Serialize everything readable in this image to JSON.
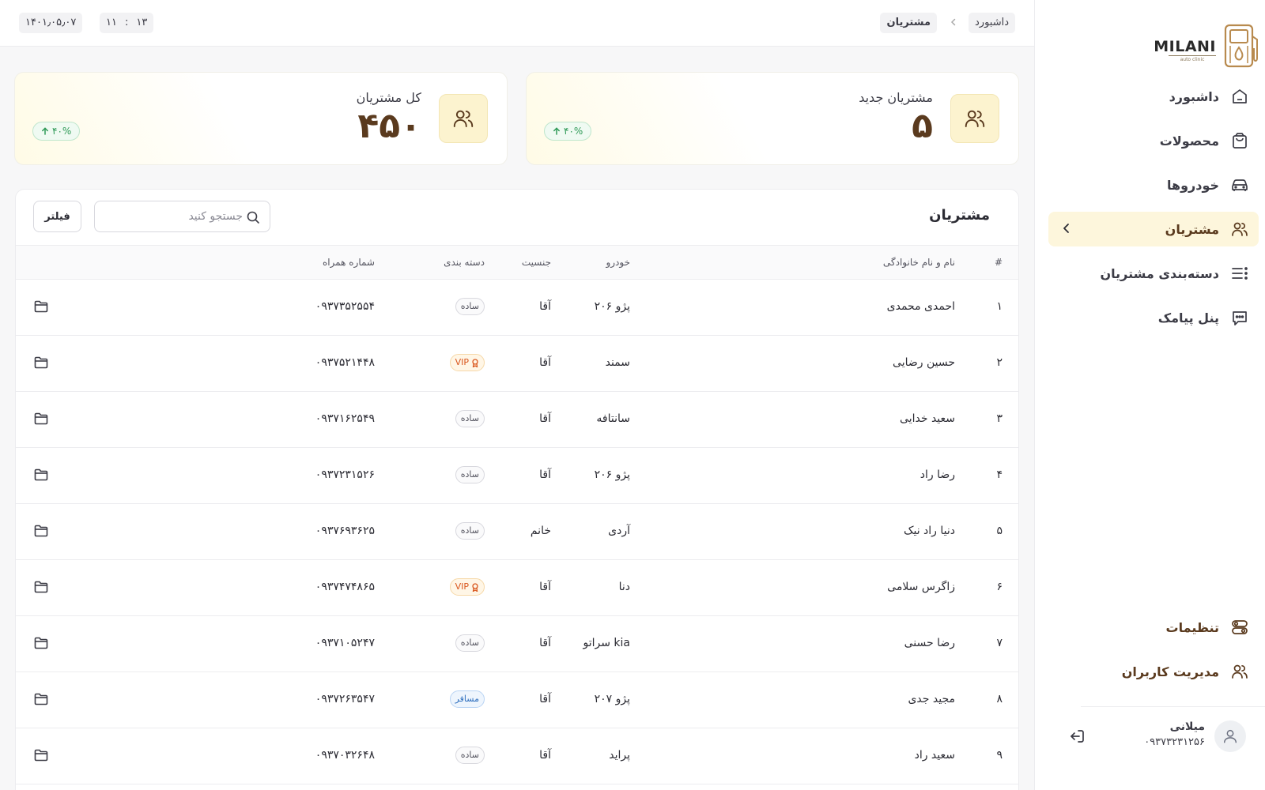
{
  "brand": {
    "name": "MILANI",
    "subtitle": "auto clinic"
  },
  "sidebar": {
    "items": [
      {
        "label": "داشبورد",
        "icon": "home-icon"
      },
      {
        "label": "محصولات",
        "icon": "shopping-bag-icon"
      },
      {
        "label": "خودروها",
        "icon": "car-icon"
      },
      {
        "label": "مشتریان",
        "icon": "users-icon",
        "active": true
      },
      {
        "label": "دسته‌بندی مشتریان",
        "icon": "list-icon"
      },
      {
        "label": "پنل پیامک",
        "icon": "message-icon"
      }
    ],
    "bottom_items": [
      {
        "label": "تنظیمات",
        "icon": "settings-icon"
      },
      {
        "label": "مدیریت کاربران",
        "icon": "users-manage-icon"
      }
    ],
    "user": {
      "name": "میلانی",
      "phone": "۰۹۳۷۳۲۳۱۲۵۶"
    }
  },
  "header": {
    "breadcrumb": [
      "داشبورد",
      "مشتریان"
    ],
    "date": "۱۴۰۱٫۰۵٫۰۷",
    "time": {
      "hour": "۱۳",
      "sep": ":",
      "minute": "۱۱"
    }
  },
  "stats": [
    {
      "title": "مشتریان جدید",
      "value": "۵",
      "change": "۴۰%"
    },
    {
      "title": "کل مشتریان",
      "value": "۴۵۰",
      "change": "۴۰%"
    }
  ],
  "table": {
    "title": "مشتریان",
    "search_placeholder": "جستجو کنید",
    "filter_label": "فیلتر",
    "columns": {
      "idx": "#",
      "name": "نام و نام خانوادگی",
      "car": "خودرو",
      "gender": "جنسیت",
      "category": "دسته بندی",
      "phone": "شماره همراه"
    },
    "rows": [
      {
        "idx": "۱",
        "name": "احمدی محمدی",
        "car": "پژو ۲۰۶",
        "gender": "آقا",
        "category": "ساده",
        "category_type": "simple",
        "phone": "۰۹۳۷۳۵۲۵۵۴"
      },
      {
        "idx": "۲",
        "name": "حسین رضایی",
        "car": "سمند",
        "gender": "آقا",
        "category": "VIP",
        "category_type": "vip",
        "phone": "۰۹۳۷۵۲۱۴۴۸"
      },
      {
        "idx": "۳",
        "name": "سعید خدایی",
        "car": "سانتافه",
        "gender": "آقا",
        "category": "ساده",
        "category_type": "simple",
        "phone": "۰۹۳۷۱۶۲۵۴۹"
      },
      {
        "idx": "۴",
        "name": "رضا راد",
        "car": "پژو ۲۰۶",
        "gender": "آقا",
        "category": "ساده",
        "category_type": "simple",
        "phone": "۰۹۳۷۲۳۱۵۲۶"
      },
      {
        "idx": "۵",
        "name": "دنیا راد نیک",
        "car": "آردی",
        "gender": "خانم",
        "category": "ساده",
        "category_type": "simple",
        "phone": "۰۹۳۷۶۹۳۶۲۵"
      },
      {
        "idx": "۶",
        "name": "زاگرس سلامی",
        "car": "دنا",
        "gender": "آقا",
        "category": "VIP",
        "category_type": "vip",
        "phone": "۰۹۳۷۴۷۴۸۶۵"
      },
      {
        "idx": "۷",
        "name": "رضا حسنی",
        "car": "سراتو kia",
        "gender": "آقا",
        "category": "ساده",
        "category_type": "simple",
        "phone": "۰۹۳۷۱۰۵۲۴۷"
      },
      {
        "idx": "۸",
        "name": "مجید جدی",
        "car": "پژو ۲۰۷",
        "gender": "آقا",
        "category": "مسافر",
        "category_type": "traveler",
        "phone": "۰۹۳۷۲۶۳۵۴۷"
      },
      {
        "idx": "۹",
        "name": "سعید راد",
        "car": "پراید",
        "gender": "آقا",
        "category": "ساده",
        "category_type": "simple",
        "phone": "۰۹۳۷۰۳۲۶۴۸"
      }
    ]
  },
  "colors": {
    "brand": "#5a3a1e",
    "accent_bg": "#fdf6dc",
    "success": "#2f9a57",
    "vip": "#d9561d",
    "traveler": "#2e6fbe"
  }
}
